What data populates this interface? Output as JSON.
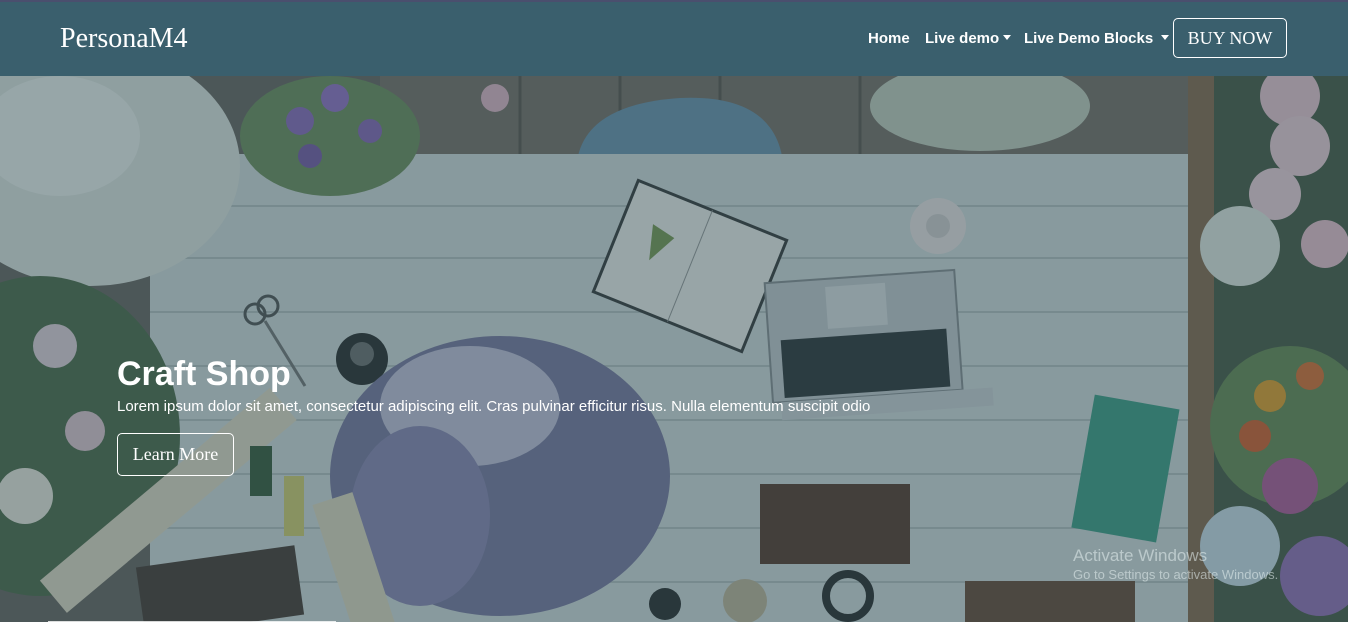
{
  "navbar": {
    "brand": "PersonaM4",
    "links": [
      {
        "label": "Home",
        "dropdown": false
      },
      {
        "label": "Live demo",
        "dropdown": true
      },
      {
        "label": "Live Demo Blocks",
        "dropdown": true
      }
    ],
    "buy_label": "BUY NOW"
  },
  "hero": {
    "title": "Craft Shop",
    "text": "Lorem ipsum dolor sit amet, consectetur adipiscing elit. Cras pulvinar efficitur risus. Nulla elementum suscipit odio",
    "button_label": "Learn More"
  },
  "watermark": {
    "title": "Activate Windows",
    "subtitle": "Go to Settings to activate Windows."
  },
  "colors": {
    "navbar": "#3a5f6d",
    "overlay": "#284650",
    "text": "#ffffff"
  }
}
